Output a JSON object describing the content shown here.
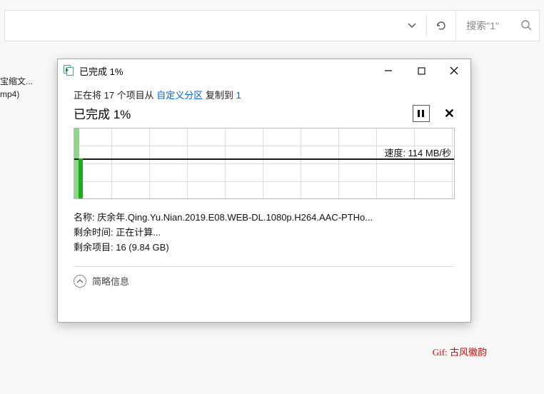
{
  "background": {
    "search_placeholder": "搜索\"1\"",
    "file_line1": "宝缩文...",
    "file_line2": "mp4)"
  },
  "dialog": {
    "title": "已完成 1%",
    "copy_prefix": "正在将 17 个项目从 ",
    "copy_source": "自定义分区",
    "copy_mid": " 复制到 ",
    "copy_dest": "1",
    "progress_label": "已完成 1%",
    "speed_label": "速度: 114 MB/秒",
    "name_label": "名称: ",
    "name_value": "庆余年.Qing.Yu.Nian.2019.E08.WEB-DL.1080p.H264.AAC-PTHo...",
    "remaining_time_label": "剩余时间: ",
    "remaining_time_value": "正在计算...",
    "remaining_items_label": "剩余项目: ",
    "remaining_items_value": "16 (9.84 GB)",
    "brief_label": "简略信息"
  },
  "watermark": "Gif: 古风徽韵"
}
